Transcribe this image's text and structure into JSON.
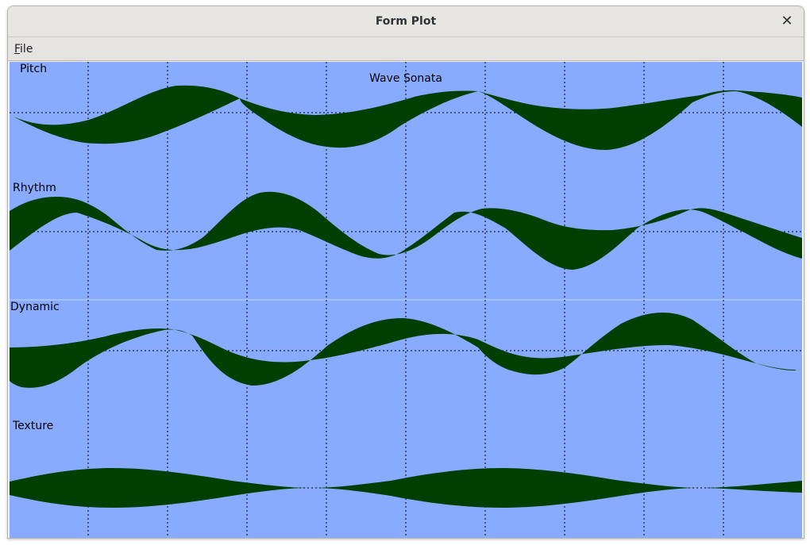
{
  "window": {
    "title": "Form Plot",
    "close_icon": "close-icon"
  },
  "menu": {
    "file_mnemonic": "F",
    "file_rest": "ile"
  },
  "plot": {
    "title": "Wave Sonata",
    "background_color": "#88abff",
    "fill_color": "#003f00",
    "grid": "dotted",
    "panels": [
      {
        "label": "Pitch"
      },
      {
        "label": "Rhythm"
      },
      {
        "label": "Dynamic"
      },
      {
        "label": "Texture"
      }
    ]
  }
}
